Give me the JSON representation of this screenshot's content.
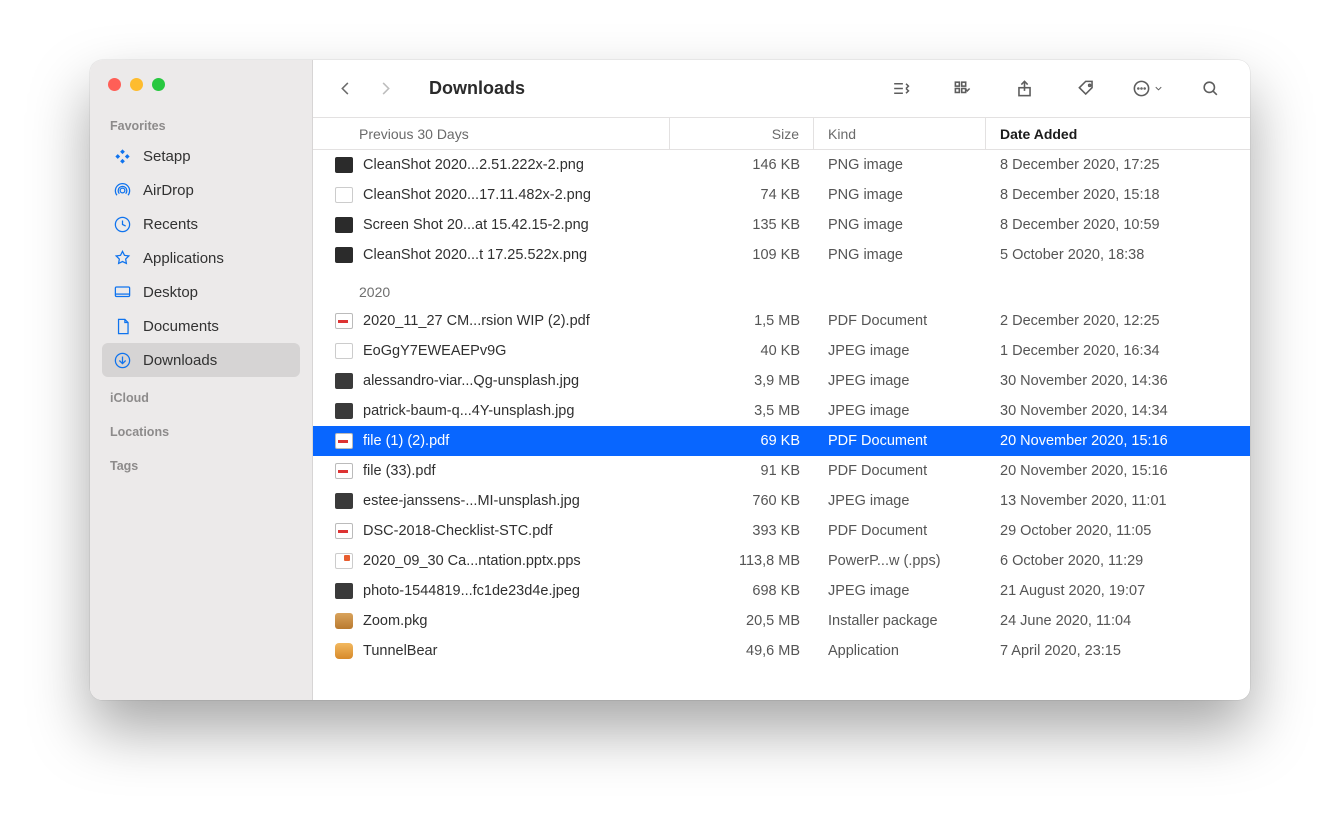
{
  "window_title": "Downloads",
  "sidebar": {
    "sections": [
      {
        "label": "Favorites",
        "items": [
          {
            "id": "setapp",
            "label": "Setapp",
            "icon": "setapp-icon"
          },
          {
            "id": "airdrop",
            "label": "AirDrop",
            "icon": "airdrop-icon"
          },
          {
            "id": "recents",
            "label": "Recents",
            "icon": "clock-icon"
          },
          {
            "id": "applications",
            "label": "Applications",
            "icon": "apps-icon"
          },
          {
            "id": "desktop",
            "label": "Desktop",
            "icon": "desktop-icon"
          },
          {
            "id": "documents",
            "label": "Documents",
            "icon": "document-icon"
          },
          {
            "id": "downloads",
            "label": "Downloads",
            "icon": "download-icon",
            "active": true
          }
        ]
      },
      {
        "label": "iCloud",
        "items": []
      },
      {
        "label": "Locations",
        "items": []
      },
      {
        "label": "Tags",
        "items": []
      }
    ]
  },
  "columns": {
    "name": "Previous 30 Days",
    "size": "Size",
    "kind": "Kind",
    "date": "Date Added"
  },
  "groups": [
    {
      "header": null,
      "rows": [
        {
          "icon": "png",
          "name": "CleanShot 2020...2.51.222x-2.png",
          "size": "146 KB",
          "kind": "PNG image",
          "date": "8 December 2020, 17:25"
        },
        {
          "icon": "txt",
          "name": "CleanShot 2020...17.11.482x-2.png",
          "size": "74 KB",
          "kind": "PNG image",
          "date": "8 December 2020, 15:18"
        },
        {
          "icon": "png",
          "name": "Screen Shot 20...at 15.42.15-2.png",
          "size": "135 KB",
          "kind": "PNG image",
          "date": "8 December 2020, 10:59"
        },
        {
          "icon": "png",
          "name": "CleanShot 2020...t 17.25.522x.png",
          "size": "109 KB",
          "kind": "PNG image",
          "date": "5 October 2020, 18:38"
        }
      ]
    },
    {
      "header": "2020",
      "rows": [
        {
          "icon": "pdf",
          "name": "2020_11_27 CM...rsion WIP (2).pdf",
          "size": "1,5 MB",
          "kind": "PDF Document",
          "date": "2 December 2020, 12:25"
        },
        {
          "icon": "txt",
          "name": "EoGgY7EWEAEPv9G",
          "size": "40 KB",
          "kind": "JPEG image",
          "date": "1 December 2020, 16:34"
        },
        {
          "icon": "jpg",
          "name": "alessandro-viar...Qg-unsplash.jpg",
          "size": "3,9 MB",
          "kind": "JPEG image",
          "date": "30 November 2020, 14:36"
        },
        {
          "icon": "jpg",
          "name": "patrick-baum-q...4Y-unsplash.jpg",
          "size": "3,5 MB",
          "kind": "JPEG image",
          "date": "30 November 2020, 14:34"
        },
        {
          "icon": "pdf",
          "name": "file (1) (2).pdf",
          "size": "69 KB",
          "kind": "PDF Document",
          "date": "20 November 2020, 15:16",
          "selected": true
        },
        {
          "icon": "pdf",
          "name": "file (33).pdf",
          "size": "91 KB",
          "kind": "PDF Document",
          "date": "20 November 2020, 15:16"
        },
        {
          "icon": "jpg",
          "name": "estee-janssens-...MI-unsplash.jpg",
          "size": "760 KB",
          "kind": "JPEG image",
          "date": "13 November 2020, 11:01"
        },
        {
          "icon": "pdf",
          "name": "DSC-2018-Checklist-STC.pdf",
          "size": "393 KB",
          "kind": "PDF Document",
          "date": "29 October 2020, 11:05"
        },
        {
          "icon": "pps",
          "name": "2020_09_30 Ca...ntation.pptx.pps",
          "size": "113,8 MB",
          "kind": "PowerP...w (.pps)",
          "date": "6 October 2020, 11:29"
        },
        {
          "icon": "jpg",
          "name": "photo-1544819...fc1de23d4e.jpeg",
          "size": "698 KB",
          "kind": "JPEG image",
          "date": "21 August 2020, 19:07"
        },
        {
          "icon": "pkg",
          "name": "Zoom.pkg",
          "size": "20,5 MB",
          "kind": "Installer package",
          "date": "24 June 2020, 11:04"
        },
        {
          "icon": "app",
          "name": "TunnelBear",
          "size": "49,6 MB",
          "kind": "Application",
          "date": "7 April 2020, 23:15"
        }
      ]
    }
  ]
}
